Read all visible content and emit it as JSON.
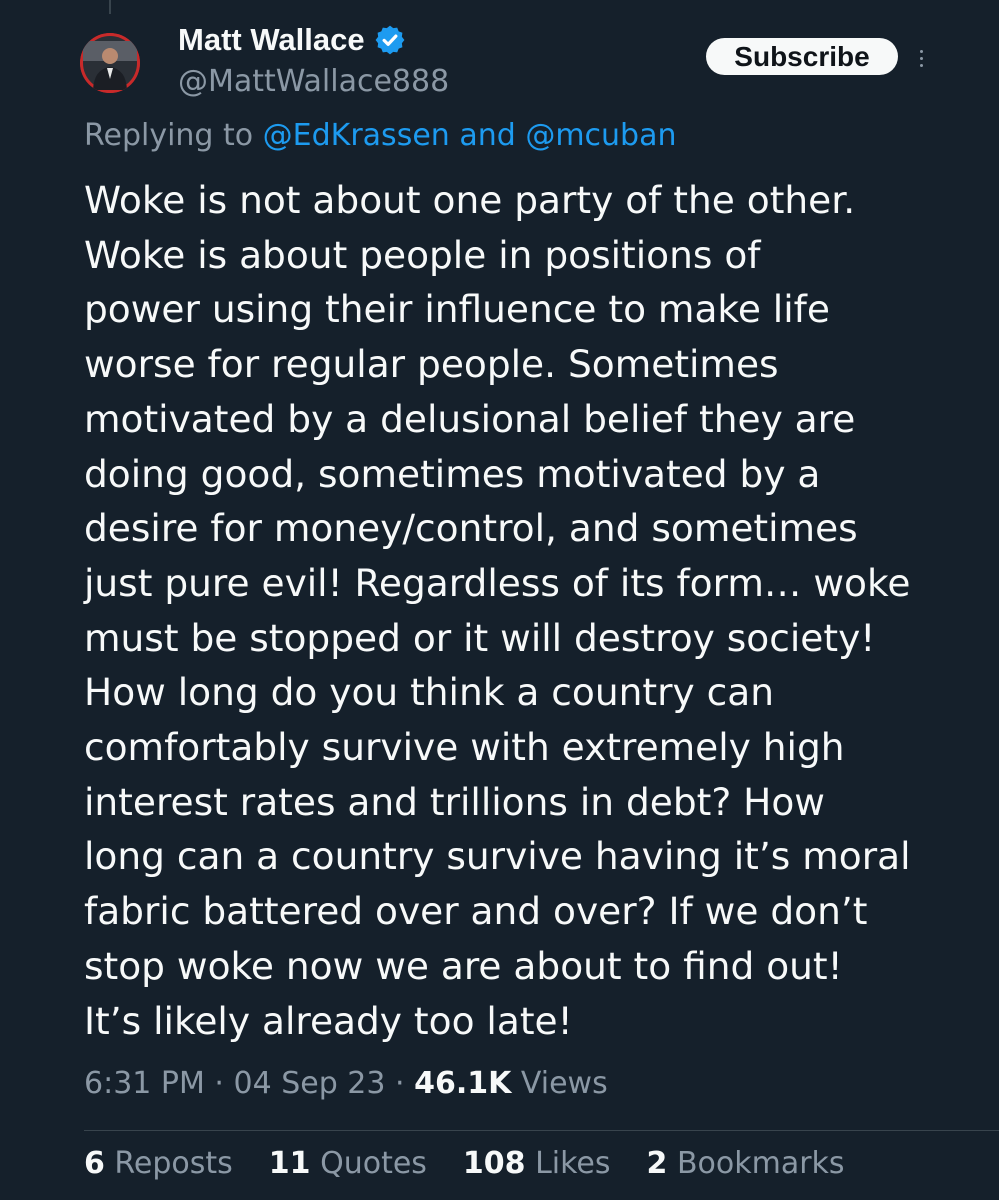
{
  "author": {
    "display_name": "Matt Wallace",
    "handle": "@MattWallace888",
    "verified": true,
    "avatar_icon": "user-avatar"
  },
  "actions": {
    "subscribe_label": "Subscribe",
    "more_icon": "more-vertical-icon"
  },
  "reply": {
    "prefix": "Replying to ",
    "mention_1": "@EdKrassen",
    "connector": " and ",
    "mention_2": "@mcuban"
  },
  "tweet": {
    "text": "Woke is not about one party of the other.\nWoke is about people in positions of\npower using their influence to make life\nworse for regular people. Sometimes\nmotivated by a delusional belief they are\ndoing good, sometimes motivated by a\ndesire for money/control, and sometimes\njust pure evil! Regardless of its form… woke\nmust be stopped or it will destroy society!\nHow long do you think a country can\ncomfortably survive with extremely high\ninterest rates and trillions in debt? How\nlong can a country survive having it’s moral\nfabric battered over and over? If we don’t\nstop woke now we are about to find out!\nIt’s likely already too late!"
  },
  "meta": {
    "time": "6:31 PM",
    "separator": " · ",
    "date": "04 Sep 23",
    "views_count": "46.1K",
    "views_label": " Views"
  },
  "stats": {
    "reposts_count": "6",
    "reposts_label": " Reposts",
    "quotes_count": "11",
    "quotes_label": " Quotes",
    "likes_count": "108",
    "likes_label": " Likes",
    "bookmarks_count": "2",
    "bookmarks_label": " Bookmarks"
  },
  "colors": {
    "background": "#15202b",
    "text_primary": "#f7f9f9",
    "text_secondary": "#8b98a5",
    "link": "#1d9bf0",
    "verified_badge": "#1d9bf0",
    "avatar_ring": "#c82a2a"
  }
}
